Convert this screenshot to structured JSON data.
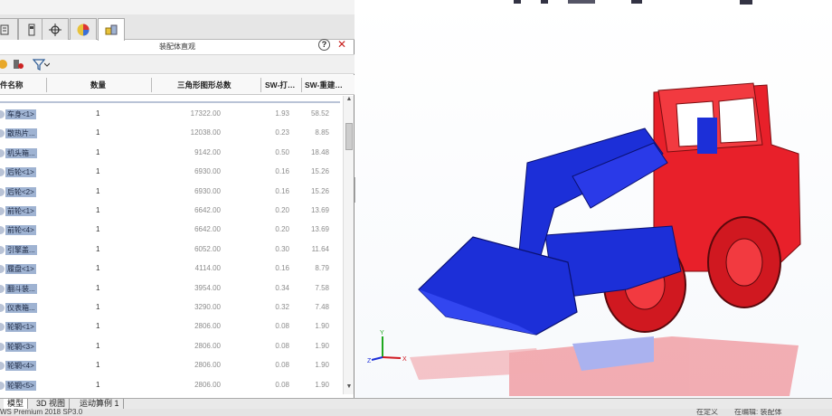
{
  "panel": {
    "title": "装配体直观",
    "help": "?",
    "close": "✕",
    "tabs": [
      "feature-manager",
      "property-manager",
      "configuration-manager",
      "display-manager",
      "assembly-visualization"
    ]
  },
  "columns": {
    "name": "件名称",
    "qty": "数量",
    "triangles": "三角形图形总数",
    "sw1": "SW-打…",
    "sw2": "SW-重建…"
  },
  "rows": [
    {
      "name": "车身<1>",
      "qty": "1",
      "tri": "17322.00",
      "sw1": "1.93",
      "sw2": "58.52"
    },
    {
      "name": "散热片...",
      "qty": "1",
      "tri": "12038.00",
      "sw1": "0.23",
      "sw2": "8.85"
    },
    {
      "name": "机头箱...",
      "qty": "1",
      "tri": "9142.00",
      "sw1": "0.50",
      "sw2": "18.48"
    },
    {
      "name": "后轮<1>",
      "qty": "1",
      "tri": "6930.00",
      "sw1": "0.16",
      "sw2": "15.26"
    },
    {
      "name": "后轮<2>",
      "qty": "1",
      "tri": "6930.00",
      "sw1": "0.16",
      "sw2": "15.26"
    },
    {
      "name": "前轮<1>",
      "qty": "1",
      "tri": "6642.00",
      "sw1": "0.20",
      "sw2": "13.69"
    },
    {
      "name": "前轮<4>",
      "qty": "1",
      "tri": "6642.00",
      "sw1": "0.20",
      "sw2": "13.69"
    },
    {
      "name": "引擎盖...",
      "qty": "1",
      "tri": "6052.00",
      "sw1": "0.30",
      "sw2": "11.64"
    },
    {
      "name": "履盘<1>",
      "qty": "1",
      "tri": "4114.00",
      "sw1": "0.16",
      "sw2": "8.79"
    },
    {
      "name": "翻斗装...",
      "qty": "1",
      "tri": "3954.00",
      "sw1": "0.34",
      "sw2": "7.58"
    },
    {
      "name": "仪表箱...",
      "qty": "1",
      "tri": "3290.00",
      "sw1": "0.32",
      "sw2": "7.48"
    },
    {
      "name": "轮辋<1>",
      "qty": "1",
      "tri": "2806.00",
      "sw1": "0.08",
      "sw2": "1.90"
    },
    {
      "name": "轮辋<3>",
      "qty": "1",
      "tri": "2806.00",
      "sw1": "0.08",
      "sw2": "1.90"
    },
    {
      "name": "轮辋<4>",
      "qty": "1",
      "tri": "2806.00",
      "sw1": "0.08",
      "sw2": "1.90"
    },
    {
      "name": "轮辋<5>",
      "qty": "1",
      "tri": "2806.00",
      "sw1": "0.08",
      "sw2": "1.90"
    }
  ],
  "bottom_tabs": [
    "模型",
    "3D 视图",
    "运动算例 1"
  ],
  "status": {
    "left": "WS Premium 2018 SP3.0",
    "mid": "在定义",
    "right1": "在编辑: 装配体"
  },
  "colors": {
    "red_parts": "#e8202a",
    "blue_parts": "#1c2fd8"
  }
}
